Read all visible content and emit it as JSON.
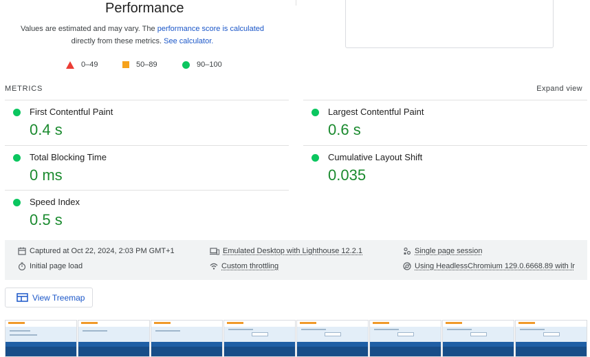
{
  "performance": {
    "title": "Performance",
    "note_prefix": "Values are estimated and may vary. The ",
    "note_link1": "performance score is calculated",
    "note_middle": "directly from these metrics.",
    "note_link2": "See calculator."
  },
  "legend": [
    {
      "shape": "triangle",
      "range": "0–49",
      "color": "#eb3d35"
    },
    {
      "shape": "square",
      "range": "50–89",
      "color": "#f6a21b"
    },
    {
      "shape": "circle",
      "range": "90–100",
      "color": "#0bc65f"
    }
  ],
  "metrics": {
    "header": "METRICS",
    "expand_label": "Expand view",
    "items": [
      {
        "label": "First Contentful Paint",
        "value": "0.4 s"
      },
      {
        "label": "Largest Contentful Paint",
        "value": "0.6 s"
      },
      {
        "label": "Total Blocking Time",
        "value": "0 ms"
      },
      {
        "label": "Cumulative Layout Shift",
        "value": "0.035"
      },
      {
        "label": "Speed Index",
        "value": "0.5 s"
      }
    ]
  },
  "run_info": {
    "captured": "Captured at Oct 22, 2024, 2:03 PM GMT+1",
    "load": "Initial page load",
    "emulation": "Emulated Desktop with Lighthouse 12.2.1",
    "throttling": "Custom throttling",
    "session": "Single page session",
    "browser": "Using HeadlessChromium 129.0.6668.89 with lr"
  },
  "treemap": {
    "label": "View Treemap"
  },
  "colors": {
    "pass": "#0bc65f",
    "value_green": "#1a8a2e",
    "link": "#1a56c8"
  }
}
